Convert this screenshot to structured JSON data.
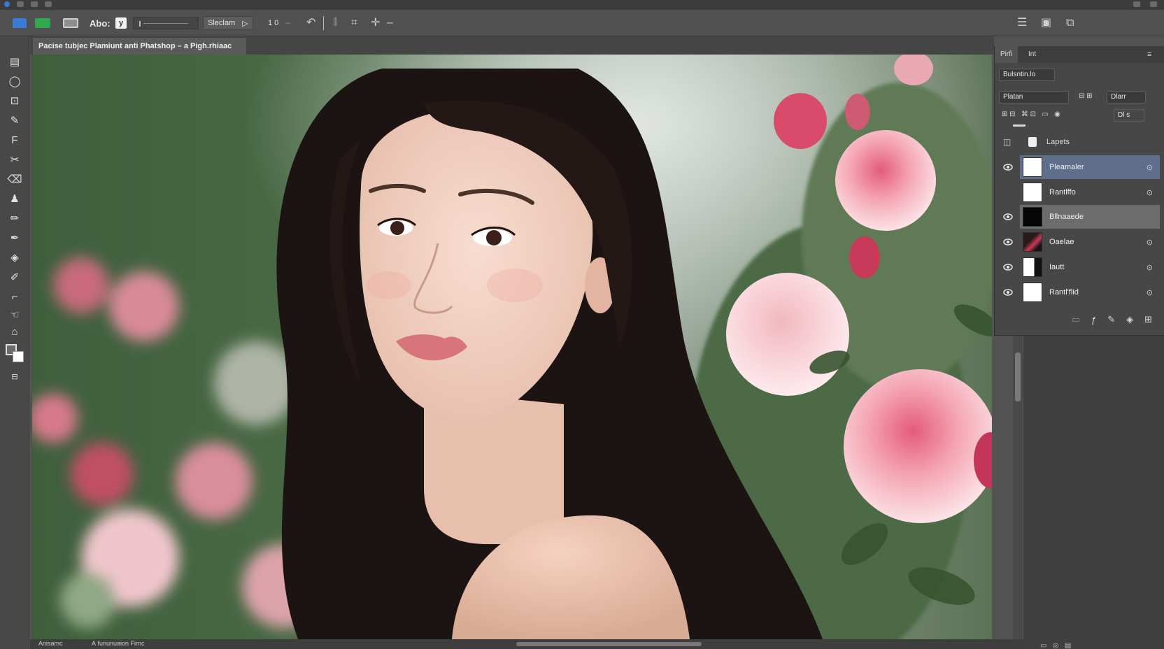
{
  "options_bar": {
    "text_tool_label": "Abo:",
    "check_glyph": "y",
    "preset_dropdown": "Sleclam",
    "preset_dropdown_arrow": "▷",
    "mode_value": "1 0"
  },
  "document": {
    "tab_title": "Pacise tubjec Plamiunt anti Phatshop – a Pigh.rhiaac"
  },
  "canvas": {
    "image_description_colors": {
      "hair": "#1c1412",
      "skin": "#efcdbd",
      "background_green": "#4f6b45",
      "rose_pink": "#f2a0b0"
    }
  },
  "status_bar": {
    "left_text": "Anisamc",
    "middle_text": "A fununuaion Firnc"
  },
  "layers_panel": {
    "tabs": [
      "Pirfi",
      "Int"
    ],
    "filter_value": "Bulsntin.lo",
    "blend_mode": "Platan",
    "opacity_label": "Dlarr",
    "fill_label": "Dl s",
    "header_label": "Lapets",
    "layers": [
      {
        "name": "Pleamaler",
        "visible": true,
        "selected": true,
        "thumb": "white"
      },
      {
        "name": "Rantlffo",
        "visible": false,
        "selected": false,
        "thumb": "white"
      },
      {
        "name": "Bllnaaede",
        "visible": true,
        "selected": false,
        "thumb": "black"
      },
      {
        "name": "Oaelae",
        "visible": true,
        "selected": false,
        "thumb": "rose"
      },
      {
        "name": "Iautt",
        "visible": true,
        "selected": false,
        "thumb": "mask"
      },
      {
        "name": "Rantl'flid",
        "visible": true,
        "selected": false,
        "thumb": "white"
      }
    ]
  },
  "accent_colors": {
    "panel_selection": "#5f6e8a",
    "toolbar_green": "#2fa84f",
    "toolbar_blue": "#3a7bd5"
  }
}
